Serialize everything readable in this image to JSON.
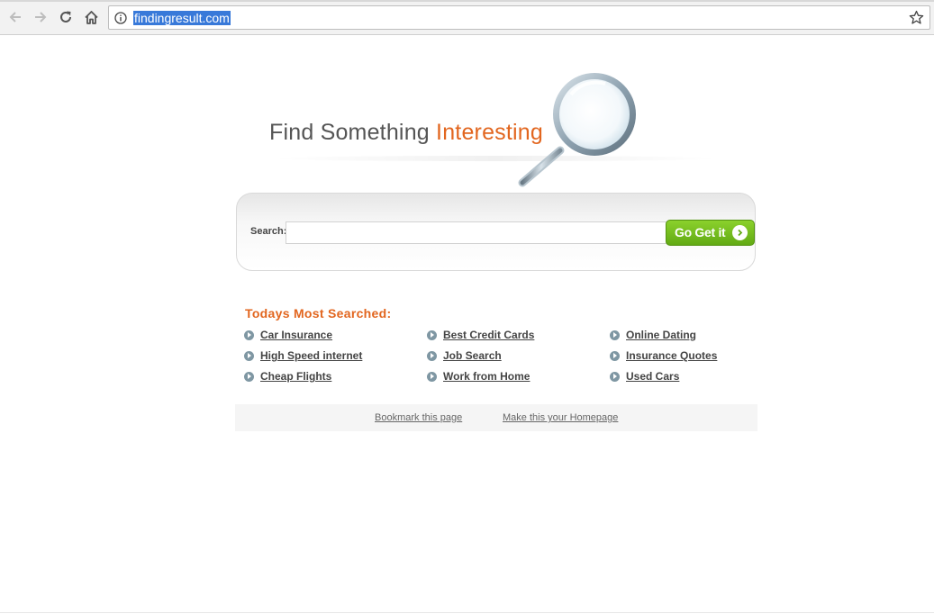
{
  "browser": {
    "url": "findingresult.com"
  },
  "hero": {
    "headline_part1": "Find Something ",
    "headline_part2": "Interesting"
  },
  "search": {
    "label": "Search:",
    "value": "",
    "button_label": "Go Get it"
  },
  "popular": {
    "title": "Todays Most Searched:",
    "links": [
      "Car Insurance",
      "Best Credit Cards",
      "Online Dating",
      "High Speed internet",
      "Job Search",
      "Insurance Quotes",
      "Cheap Flights",
      "Work from Home",
      "Used Cars"
    ]
  },
  "footer": {
    "bookmark": "Bookmark this page",
    "homepage": "Make this your Homepage"
  },
  "colors": {
    "accent_orange": "#e2661f",
    "button_green": "#6cb61a",
    "bullet": "#7f97a3"
  },
  "icons": [
    "back-icon",
    "forward-icon",
    "reload-icon",
    "home-icon",
    "info-icon",
    "star-icon",
    "magnifier-icon",
    "arrow-right-icon"
  ]
}
